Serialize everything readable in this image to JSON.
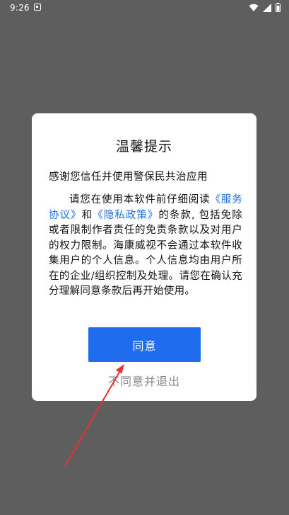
{
  "status_bar": {
    "time": "9:26",
    "icons": [
      "notification-icon",
      "wifi-icon",
      "signal-icon",
      "battery-icon"
    ]
  },
  "dialog": {
    "title": "温馨提示",
    "subtitle": "感谢您信任并使用警保民共治应用",
    "body": {
      "part1": "请您在使用本软件前仔细阅读",
      "service_link": "《服务协议》",
      "and": "和",
      "privacy_link": "《隐私政策》",
      "part2": "的条款, 包括免除或者限制作者责任的免责条款以及对用户的权力限制。海康威视不会通过本软件收集用户的个人信息。个人信息均由用户所在的企业/组织控制及处理。请您在确认充分理解同意条款后再开始使用。"
    },
    "agree_label": "同意",
    "disagree_label": "不同意并退出"
  },
  "colors": {
    "overlay": "#5e5e5e",
    "accent": "#1f6cee",
    "link": "#1e6fe0",
    "annotation": "#e8322b"
  }
}
